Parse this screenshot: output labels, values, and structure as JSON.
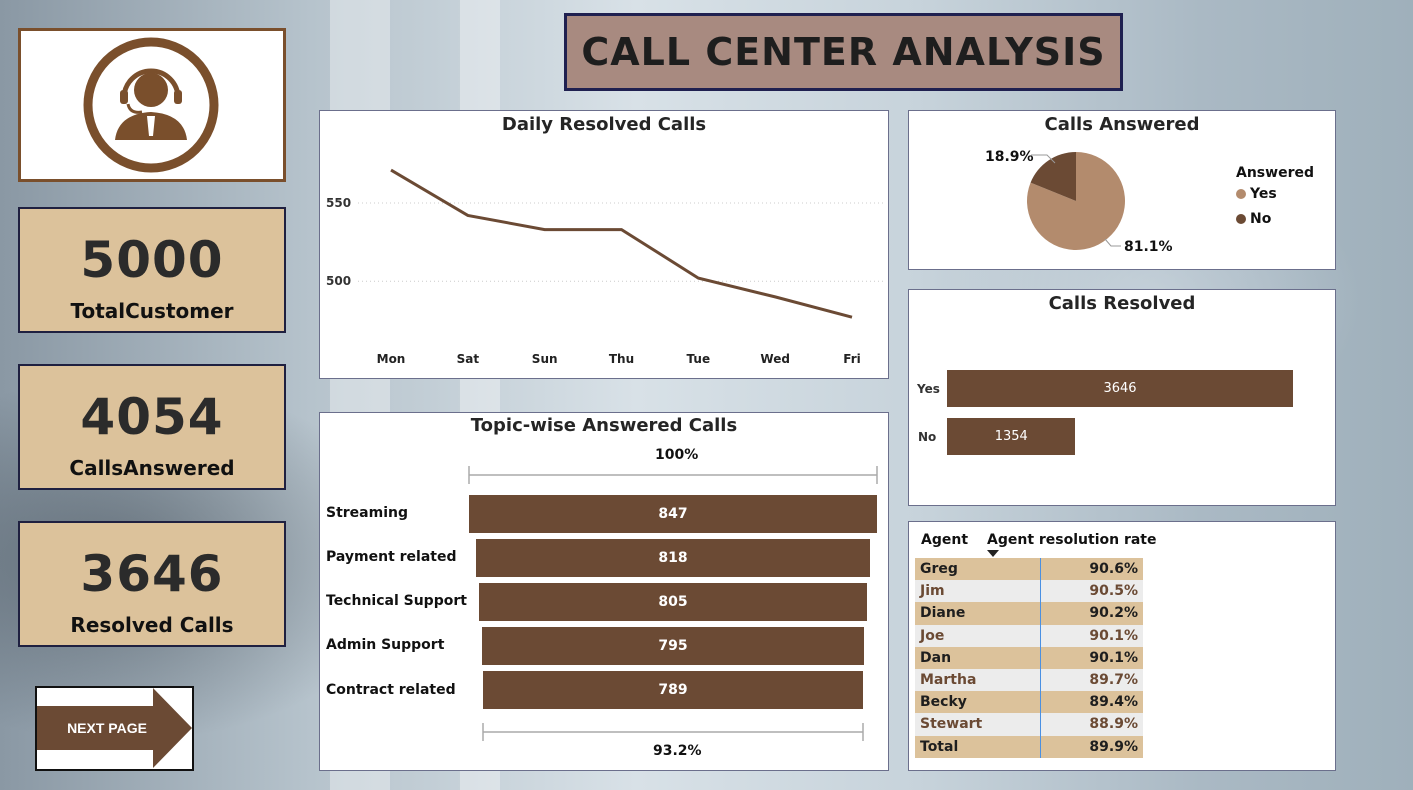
{
  "title": "CALL CENTER ANALYSIS",
  "nav": {
    "next_label": "NEXT PAGE"
  },
  "kpis": [
    {
      "value": "5000",
      "label": "TotalCustomer"
    },
    {
      "value": "4054",
      "label": "CallsAnswered"
    },
    {
      "value": "3646",
      "label": "Resolved Calls"
    }
  ],
  "colors": {
    "brand": "#6b4a34",
    "light_brown": "#b38b6d",
    "kpi_bg": "#dcc29b",
    "title_bg": "#a88a80"
  },
  "icons": {
    "logo": "headset-agent-icon",
    "next": "arrow-right-icon"
  },
  "chart_data": [
    {
      "type": "line",
      "title": "Daily Resolved Calls",
      "x": [
        "Mon",
        "Sat",
        "Sun",
        "Thu",
        "Tue",
        "Wed",
        "Fri"
      ],
      "series": [
        {
          "values": [
            571,
            542,
            533,
            533,
            502,
            490,
            477
          ]
        }
      ],
      "yticks": [
        "550",
        "500"
      ],
      "ylim": [
        465,
        580
      ],
      "grid": true
    },
    {
      "type": "pie",
      "title": "Calls Answered",
      "legend_title": "Answered",
      "legend_position": "right",
      "slices": [
        {
          "label": "Yes",
          "value": 81.1,
          "display": "81.1%",
          "color": "#b38b6d"
        },
        {
          "label": "No",
          "value": 18.9,
          "display": "18.9%",
          "color": "#6b4a34"
        }
      ]
    },
    {
      "type": "bar",
      "title": "Calls Resolved",
      "orientation": "horizontal",
      "categories": [
        "Yes",
        "No"
      ],
      "values": [
        3646,
        1354
      ],
      "labels": [
        "3646",
        "1354"
      ]
    },
    {
      "type": "bar",
      "title": "Topic-wise Answered Calls",
      "orientation": "horizontal-funnel",
      "categories": [
        "Streaming",
        "Payment related",
        "Technical Support",
        "Admin Support",
        "Contract related"
      ],
      "values": [
        847,
        818,
        805,
        795,
        789
      ],
      "labels": [
        "847",
        "818",
        "805",
        "795",
        "789"
      ],
      "top_label": "100%",
      "bottom_label": "93.2%"
    },
    {
      "type": "table",
      "headers": [
        "Agent",
        "Agent resolution rate"
      ],
      "rows": [
        {
          "agent": "Greg",
          "rate": "90.6%"
        },
        {
          "agent": "Jim",
          "rate": "90.5%"
        },
        {
          "agent": "Diane",
          "rate": "90.2%"
        },
        {
          "agent": "Joe",
          "rate": "90.1%"
        },
        {
          "agent": "Dan",
          "rate": "90.1%"
        },
        {
          "agent": "Martha",
          "rate": "89.7%"
        },
        {
          "agent": "Becky",
          "rate": "89.4%"
        },
        {
          "agent": "Stewart",
          "rate": "88.9%"
        }
      ],
      "total": {
        "agent": "Total",
        "rate": "89.9%"
      }
    }
  ]
}
